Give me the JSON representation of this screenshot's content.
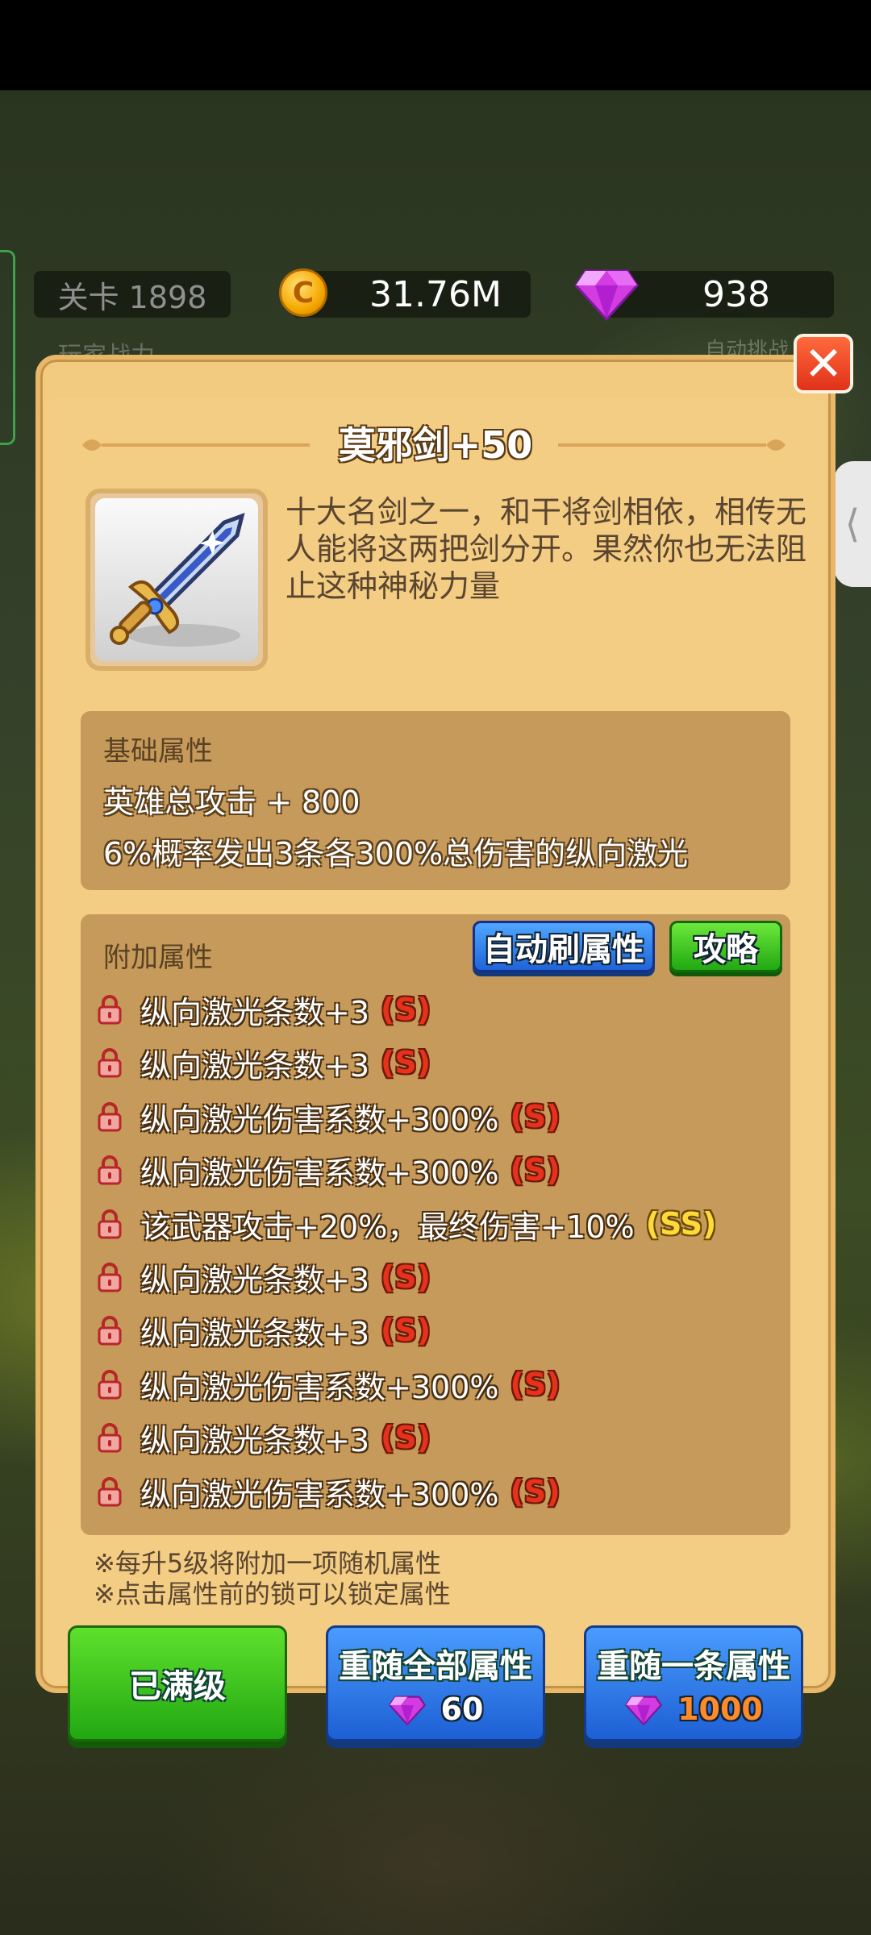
{
  "hud": {
    "stage": "关卡 1898",
    "coins": "31.76M",
    "gems": "938",
    "faded_left": "玩家战力",
    "faded_right": "自动挑战"
  },
  "panel": {
    "title": "莫邪剑+50",
    "description": "十大名剑之一，和干将剑相依，相传无人能将这两把剑分开。果然你也无法阻止这种神秘力量",
    "base": {
      "title": "基础属性",
      "lines": [
        "英雄总攻击 + 800",
        "6%概率发出3条各300%总伤害的纵向激光"
      ]
    },
    "extra": {
      "title": "附加属性",
      "auto_button": "自动刷属性",
      "guide_button": "攻略",
      "attributes": [
        {
          "text": "纵向激光条数+3",
          "grade": "(S)"
        },
        {
          "text": "纵向激光条数+3",
          "grade": "(S)"
        },
        {
          "text": "纵向激光伤害系数+300%",
          "grade": "(S)"
        },
        {
          "text": "纵向激光伤害系数+300%",
          "grade": "(S)"
        },
        {
          "text": "该武器攻击+20%，最终伤害+10%",
          "grade": "(SS)"
        },
        {
          "text": "纵向激光条数+3",
          "grade": "(S)"
        },
        {
          "text": "纵向激光条数+3",
          "grade": "(S)"
        },
        {
          "text": "纵向激光伤害系数+300%",
          "grade": "(S)"
        },
        {
          "text": "纵向激光条数+3",
          "grade": "(S)"
        },
        {
          "text": "纵向激光伤害系数+300%",
          "grade": "(S)"
        }
      ]
    },
    "notes": [
      "※每升5级将附加一项随机属性",
      "※点击属性前的锁可以锁定属性"
    ]
  },
  "buttons": {
    "max_level": "已满级",
    "reroll_all": {
      "label": "重随全部属性",
      "cost": "60"
    },
    "reroll_one": {
      "label": "重随一条属性",
      "cost": "1000"
    }
  },
  "icons": {
    "close": "close-icon",
    "lock": "lock-icon",
    "gem": "gem-icon",
    "coin": "coin-icon",
    "weapon": "sword-icon"
  },
  "colors": {
    "panel_bg": "#f2cb80",
    "section_bg": "#c69a5a",
    "grade_s": "#e8311c",
    "grade_ss": "#ffd93a",
    "button_blue": "#2f7ff0",
    "button_green": "#36c21c"
  }
}
